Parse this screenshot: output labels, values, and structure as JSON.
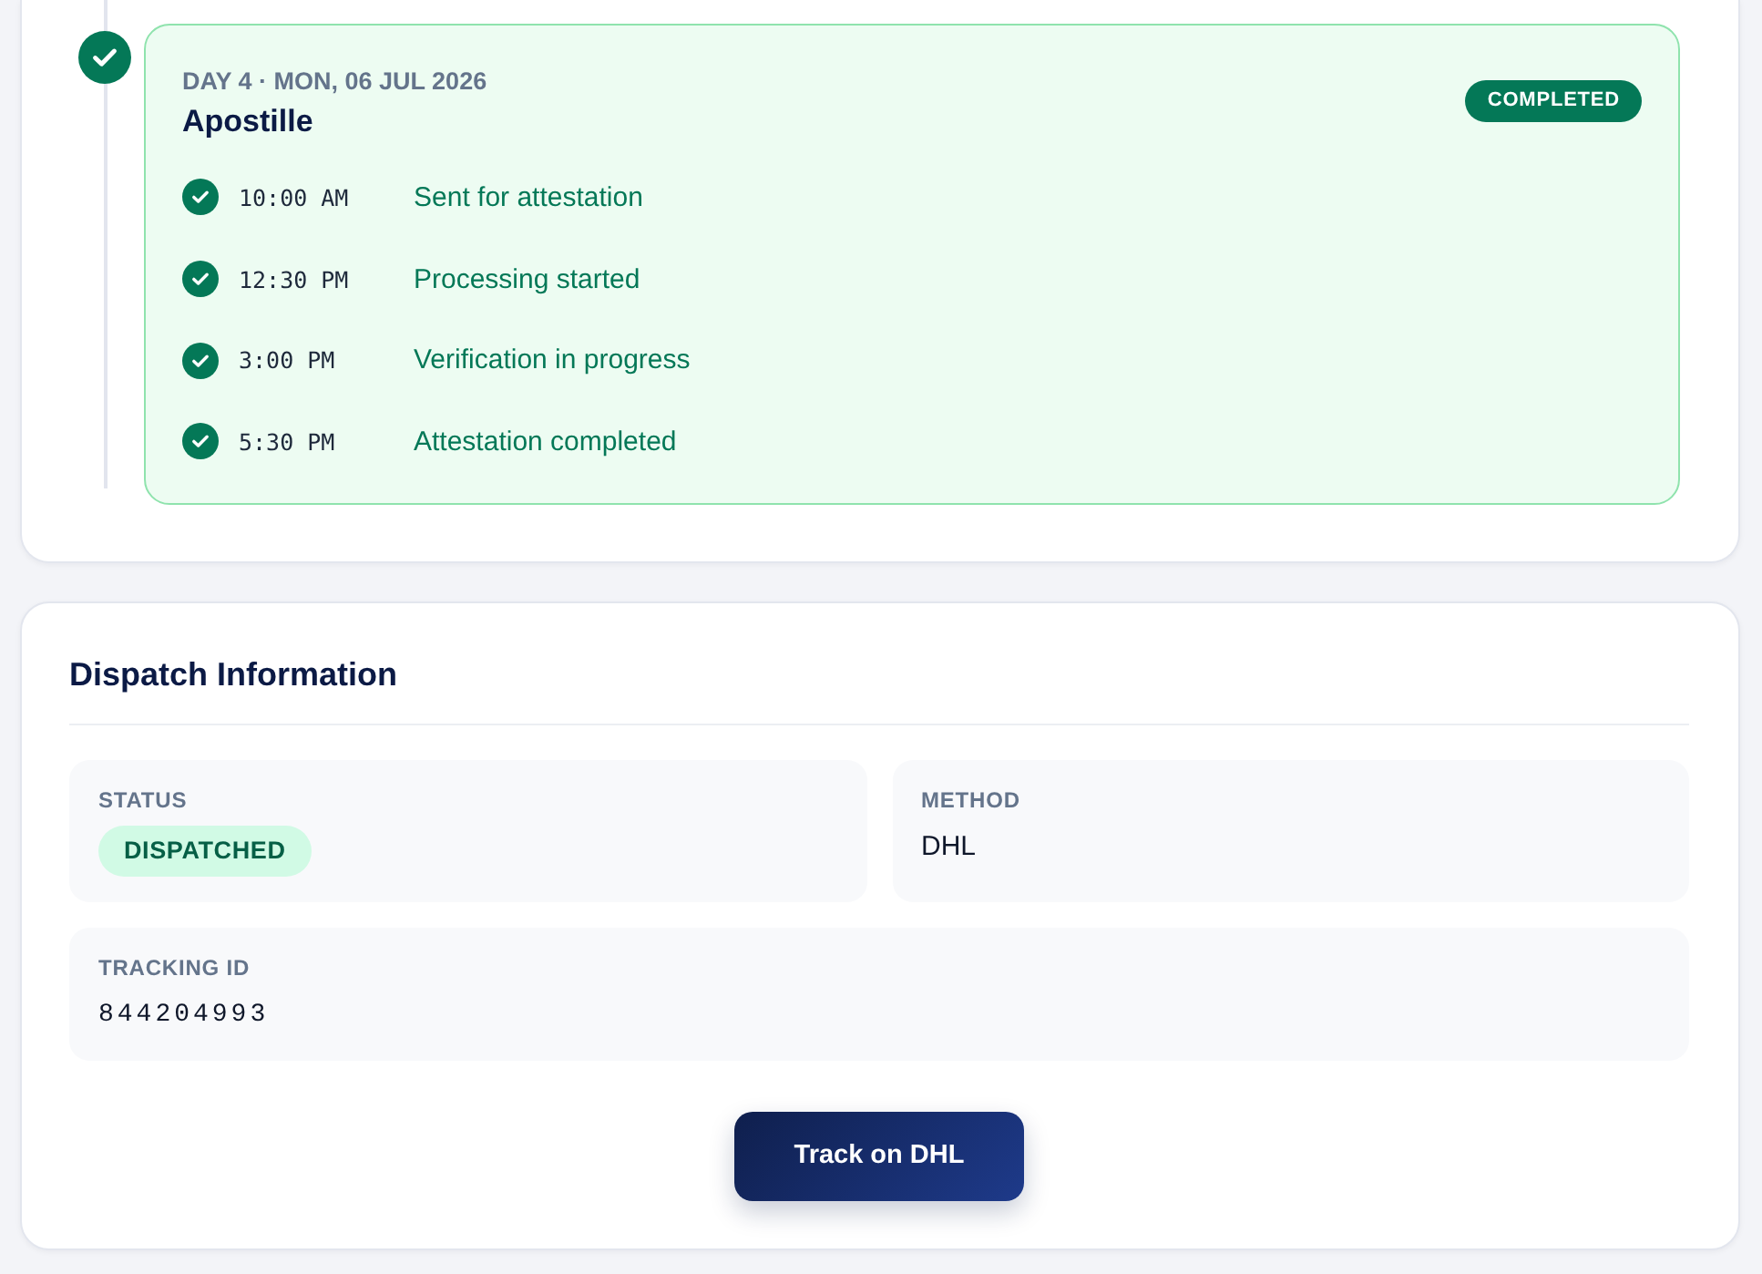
{
  "timeline": {
    "days": [
      {
        "completed": true,
        "day_label": "DAY 4 · MON, 06 JUL 2026",
        "title": "Apostille",
        "badge": "COMPLETED",
        "events": [
          {
            "time": "10:00 AM",
            "description": "Sent for attestation",
            "done": true
          },
          {
            "time": "12:30 PM",
            "description": "Processing started",
            "done": true
          },
          {
            "time": "3:00 PM",
            "description": "Verification in progress",
            "done": true
          },
          {
            "time": "5:30 PM",
            "description": "Attestation completed",
            "done": true
          }
        ]
      }
    ]
  },
  "dispatch": {
    "title": "Dispatch Information",
    "fields": [
      {
        "kind": "pill",
        "label": "STATUS",
        "value": "DISPATCHED"
      },
      {
        "kind": "text",
        "label": "METHOD",
        "value": "DHL"
      },
      {
        "kind": "mono",
        "label": "TRACKING ID",
        "value": "844204993"
      }
    ],
    "button": {
      "label": "Track on DHL"
    }
  }
}
